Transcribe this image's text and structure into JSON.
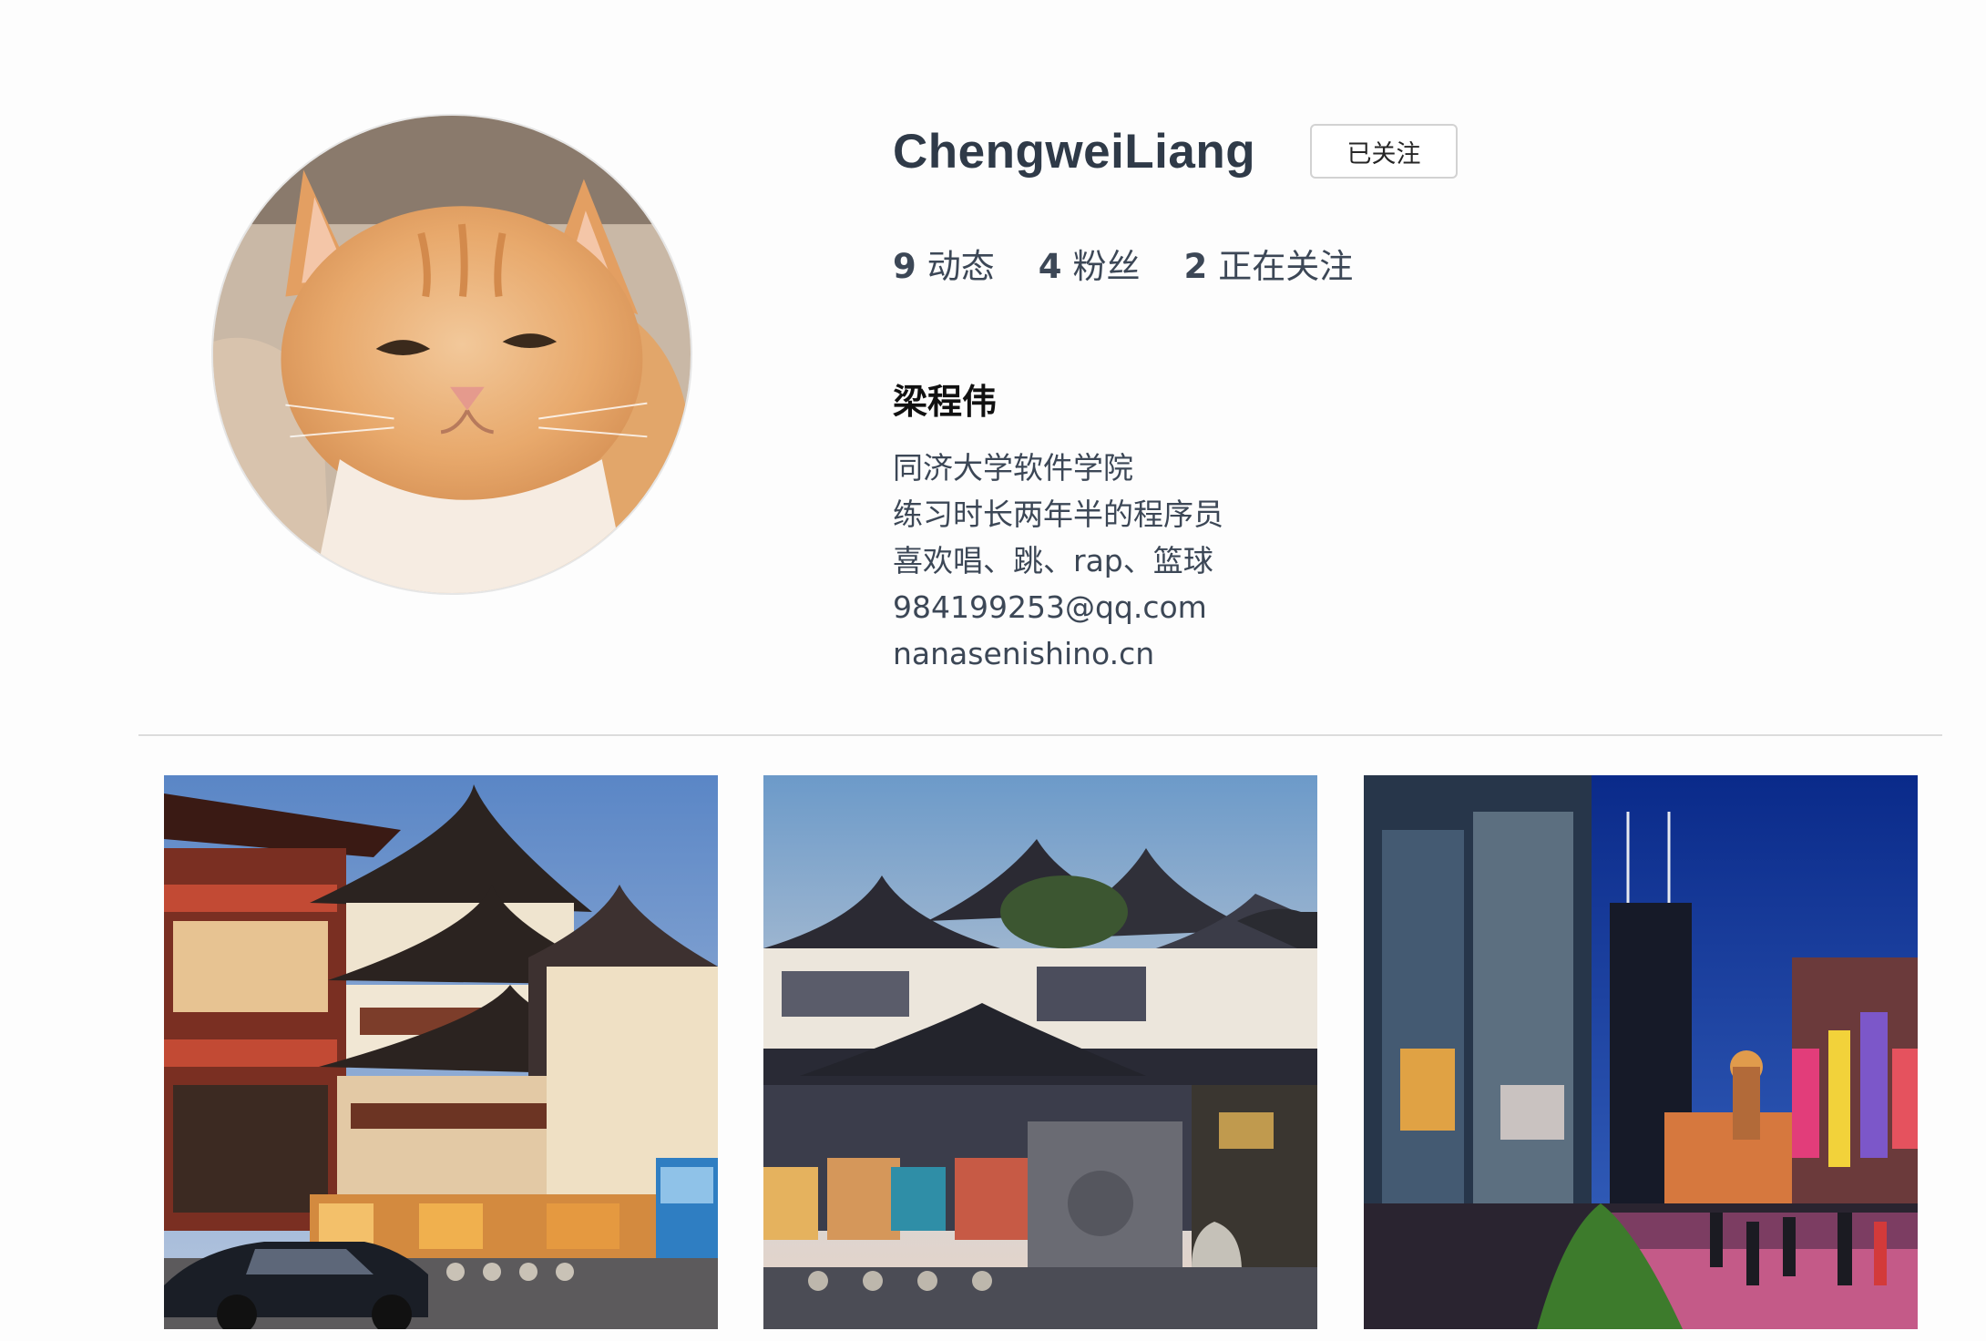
{
  "profile": {
    "username": "ChengweiLiang",
    "follow_button_label": "已关注",
    "stats": [
      {
        "count": "9",
        "label": "动态"
      },
      {
        "count": "4",
        "label": "粉丝"
      },
      {
        "count": "2",
        "label": "正在关注"
      }
    ],
    "real_name": "梁程伟",
    "bio_lines": [
      "同济大学软件学院",
      "练习时长两年半的程序员",
      "喜欢唱、跳、rap、篮球",
      "984199253@qq.com",
      "nanasenishino.cn"
    ]
  },
  "posts": [
    {
      "image": "yuyuan-garden-dusk-photo"
    },
    {
      "image": "yuyuan-temple-evening-photo"
    },
    {
      "image": "nanjing-road-night-photo"
    }
  ],
  "colors": {
    "username": "#2f3a48",
    "text": "#3c4756",
    "divider": "#dcdcdc"
  }
}
